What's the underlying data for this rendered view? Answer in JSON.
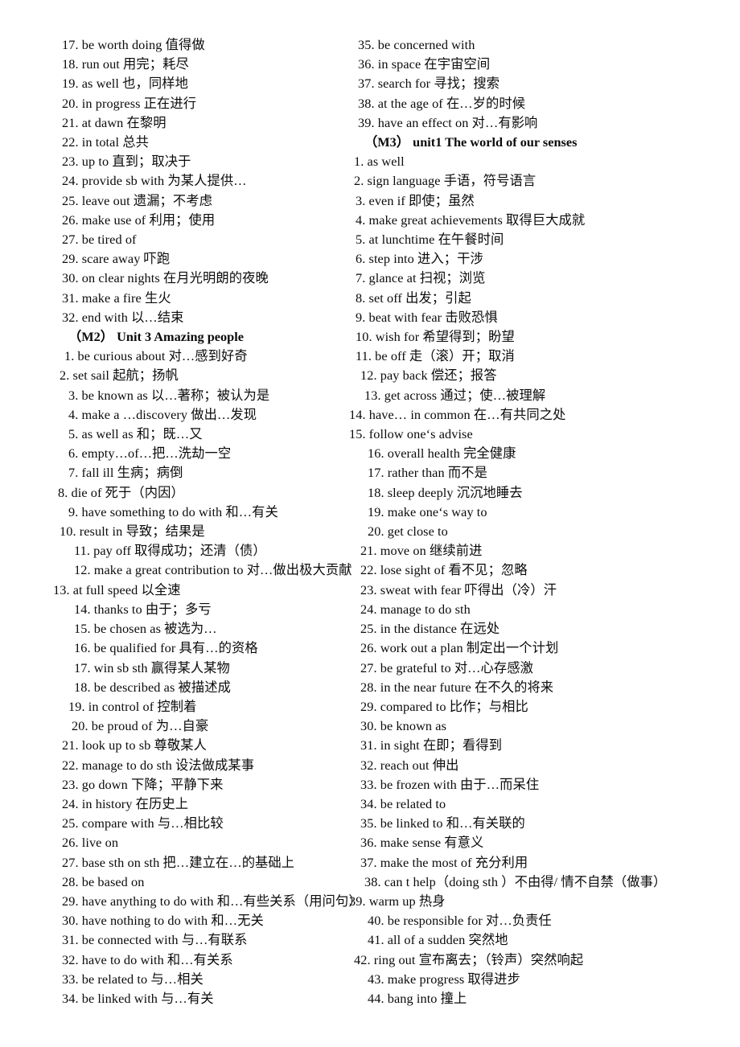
{
  "document": {
    "type": "vocabulary-phrase-list",
    "language": "English-Chinese",
    "columns": 2
  },
  "left_column": [
    {
      "kind": "entry",
      "num": "17.",
      "text": "be worth doing  值得做",
      "indent": "i2"
    },
    {
      "kind": "entry",
      "num": "18.",
      "text": "run out  用完；耗尽",
      "indent": "i2"
    },
    {
      "kind": "entry",
      "num": "19.",
      "text": "as well  也，同样地",
      "indent": "i2"
    },
    {
      "kind": "entry",
      "num": "20.",
      "text": "in progress  正在进行",
      "indent": "i2"
    },
    {
      "kind": "entry",
      "num": "21.",
      "text": "at dawn  在黎明",
      "indent": "i2"
    },
    {
      "kind": "entry",
      "num": "22.",
      "text": "in total 总共",
      "indent": "i2"
    },
    {
      "kind": "entry",
      "num": "23.",
      "text": "up to  直到；取决于",
      "indent": "i2"
    },
    {
      "kind": "entry",
      "num": "24.",
      "text": "provide sb with  为某人提供…",
      "indent": "i2"
    },
    {
      "kind": "entry",
      "num": "25.",
      "text": "leave out  遗漏；不考虑",
      "indent": "i2"
    },
    {
      "kind": "entry",
      "num": "26.",
      "text": "make use of  利用；使用",
      "indent": "i2"
    },
    {
      "kind": "entry",
      "num": "27.",
      "text": "be tired of",
      "indent": "i2"
    },
    {
      "kind": "entry",
      "num": "29.",
      "text": "scare away 吓跑",
      "indent": "i2"
    },
    {
      "kind": "entry",
      "num": "30.",
      "text": "on clear nights  在月光明朗的夜晚",
      "indent": "i2"
    },
    {
      "kind": "entry",
      "num": "31.",
      "text": "make a fire  生火",
      "indent": "i2"
    },
    {
      "kind": "entry",
      "num": "32.",
      "text": "end with 以…结束",
      "indent": "i2"
    },
    {
      "kind": "heading",
      "text": "（M2）   Unit 3 Amazing people",
      "indent": "i4"
    },
    {
      "kind": "entry",
      "num": "1.",
      "text": "be curious about  对…感到好奇",
      "indent": "i3"
    },
    {
      "kind": "entry",
      "num": "2.",
      "text": "set sail  起航；扬帆",
      "indent": "i1"
    },
    {
      "kind": "entry",
      "num": "3.",
      "text": "be known as 以…著称；被认为是",
      "indent": "i4"
    },
    {
      "kind": "entry",
      "num": "4.",
      "text": "make a  …discovery  做出…发现",
      "indent": "i4"
    },
    {
      "kind": "entry",
      "num": "5.",
      "text": "as well as  和；既…又",
      "indent": "i4"
    },
    {
      "kind": "entry",
      "num": "6.",
      "text": "empty…of…把…洗劫一空",
      "indent": "i4"
    },
    {
      "kind": "entry",
      "num": "7.",
      "text": "fall ill  生病；病倒",
      "indent": "i4"
    },
    {
      "kind": "entry",
      "num": "8.",
      "text": "die of  死于（内因）",
      "indent": "i0"
    },
    {
      "kind": "entry",
      "num": "9.",
      "text": "have something to do with 和…有关",
      "indent": "i4"
    },
    {
      "kind": "entry",
      "num": "10.",
      "text": "result in  导致；结果是",
      "indent": "i1"
    },
    {
      "kind": "entry",
      "num": "11.",
      "text": "pay off 取得成功；还清（债）",
      "indent": "i6"
    },
    {
      "kind": "entry",
      "num": "12.",
      "text": "make a great contribution to 对…做出极大贡献",
      "indent": "i6"
    },
    {
      "kind": "entry",
      "num": "13.",
      "text": "at full speed  以全速",
      "indent": "ineg"
    },
    {
      "kind": "entry",
      "num": "14.",
      "text": "thanks to  由于；多亏",
      "indent": "i6"
    },
    {
      "kind": "entry",
      "num": "15.",
      "text": "be chosen as 被选为…",
      "indent": "i6"
    },
    {
      "kind": "entry",
      "num": "16.",
      "text": "be qualified for 具有…的资格",
      "indent": "i6"
    },
    {
      "kind": "entry",
      "num": "17.",
      "text": "win sb sth 赢得某人某物",
      "indent": "i6"
    },
    {
      "kind": "entry",
      "num": "18.",
      "text": "be described as  被描述成",
      "indent": "i6"
    },
    {
      "kind": "entry",
      "num": "19.",
      "text": "in control of  控制着",
      "indent": "i4"
    },
    {
      "kind": "entry",
      "num": "20.",
      "text": "be proud of  为…自豪",
      "indent": "i5"
    },
    {
      "kind": "entry",
      "num": "21.",
      "text": "look up to sb  尊敬某人",
      "indent": "i2"
    },
    {
      "kind": "entry",
      "num": "22.",
      "text": "manage to do sth 设法做成某事",
      "indent": "i2"
    },
    {
      "kind": "entry",
      "num": "23.",
      "text": "go down  下降；平静下来",
      "indent": "i2"
    },
    {
      "kind": "entry",
      "num": "24.",
      "text": "in history 在历史上",
      "indent": "i2"
    },
    {
      "kind": "entry",
      "num": "25.",
      "text": "compare with 与…相比较",
      "indent": "i2"
    },
    {
      "kind": "entry",
      "num": "26.",
      "text": "live on",
      "indent": "i2"
    },
    {
      "kind": "entry",
      "num": "27.",
      "text": "base sth on sth  把…建立在…的基础上",
      "indent": "i2"
    },
    {
      "kind": "entry",
      "num": "28.",
      "text": "be based on",
      "indent": "i2"
    },
    {
      "kind": "entry",
      "num": "29.",
      "text": "have anything to do with 和…有些关系（用问句）",
      "indent": "i2"
    },
    {
      "kind": "entry",
      "num": "30.",
      "text": "have nothing to do with  和…无关",
      "indent": "i2"
    },
    {
      "kind": "entry",
      "num": "31.",
      "text": "be connected with  与…有联系",
      "indent": "i2"
    },
    {
      "kind": "entry",
      "num": "32.",
      "text": "have to do with  和…有关系",
      "indent": "i2"
    },
    {
      "kind": "entry",
      "num": "33.",
      "text": "be related to  与…相关",
      "indent": "i2"
    },
    {
      "kind": "entry",
      "num": "34.",
      "text": "be linked with 与…有关",
      "indent": "i2"
    }
  ],
  "right_column": [
    {
      "kind": "entry",
      "num": "35.",
      "text": "be concerned with",
      "indent": "i2"
    },
    {
      "kind": "entry",
      "num": "36.",
      "text": "in space 在宇宙空间",
      "indent": "i2"
    },
    {
      "kind": "entry",
      "num": "37.",
      "text": "search for 寻找；搜索",
      "indent": "i2"
    },
    {
      "kind": "entry",
      "num": "38.",
      "text": "at the age of  在…岁的时候",
      "indent": "i2"
    },
    {
      "kind": "entry",
      "num": "39.",
      "text": "have an effect on  对…有影响",
      "indent": "i2"
    },
    {
      "kind": "heading",
      "text": "（M3）   unit1 The world of our senses",
      "indent": "i4"
    },
    {
      "kind": "entry",
      "num": "1.",
      "text": "as well",
      "indent": "i0"
    },
    {
      "kind": "entry",
      "num": "2.",
      "text": "sign language 手语，符号语言",
      "indent": "i0"
    },
    {
      "kind": "entry",
      "num": "3.",
      "text": "even if 即使；虽然",
      "indent": "i1"
    },
    {
      "kind": "entry",
      "num": "4.",
      "text": "make great achievements 取得巨大成就",
      "indent": "i1"
    },
    {
      "kind": "entry",
      "num": "5.",
      "text": "at lunchtime 在午餐时间",
      "indent": "i1"
    },
    {
      "kind": "entry",
      "num": "6.",
      "text": "step into 进入；干涉",
      "indent": "i1"
    },
    {
      "kind": "entry",
      "num": "7.",
      "text": "glance at 扫视；浏览",
      "indent": "i1"
    },
    {
      "kind": "entry",
      "num": "8.",
      "text": "set off 出发；引起",
      "indent": "i1"
    },
    {
      "kind": "entry",
      "num": "9.",
      "text": "beat with fear  击败恐惧",
      "indent": "i1"
    },
    {
      "kind": "entry",
      "num": "10.",
      "text": "wish for 希望得到；盼望",
      "indent": "i1"
    },
    {
      "kind": "entry",
      "num": "11.",
      "text": "be off 走（滚）开；取消",
      "indent": "i1"
    },
    {
      "kind": "entry",
      "num": "12.",
      "text": "pay back 偿还；报答",
      "indent": "i3"
    },
    {
      "kind": "entry",
      "num": "13.",
      "text": "get across 通过；使…被理解",
      "indent": "i4"
    },
    {
      "kind": "entry",
      "num": "14.",
      "text": "have…  in common 在…有共同之处",
      "indent": "ineg"
    },
    {
      "kind": "entry",
      "num": "15.",
      "text": "follow one‘s advise",
      "indent": "ineg"
    },
    {
      "kind": "entry",
      "num": "16.",
      "text": "overall health 完全健康",
      "indent": "i5"
    },
    {
      "kind": "entry",
      "num": "17.",
      "text": "rather than  而不是",
      "indent": "i5"
    },
    {
      "kind": "entry",
      "num": "18.",
      "text": "sleep deeply 沉沉地睡去",
      "indent": "i5"
    },
    {
      "kind": "entry",
      "num": "19.",
      "text": "make one‘s way to",
      "indent": "i5"
    },
    {
      "kind": "entry",
      "num": "20.",
      "text": "get close to",
      "indent": "i5"
    },
    {
      "kind": "entry",
      "num": "21.",
      "text": "move on  继续前进",
      "indent": "i3"
    },
    {
      "kind": "entry",
      "num": "22.",
      "text": "lose sight of  看不见；忽略",
      "indent": "i3"
    },
    {
      "kind": "entry",
      "num": "23.",
      "text": "sweat with fear  吓得出（冷）汗",
      "indent": "i3"
    },
    {
      "kind": "entry",
      "num": "24.",
      "text": "manage to do sth",
      "indent": "i3"
    },
    {
      "kind": "entry",
      "num": "25.",
      "text": "in the distance  在远处",
      "indent": "i3"
    },
    {
      "kind": "entry",
      "num": "26.",
      "text": "work out a plan  制定出一个计划",
      "indent": "i3"
    },
    {
      "kind": "entry",
      "num": "27.",
      "text": "be grateful to 对…心存感激",
      "indent": "i3"
    },
    {
      "kind": "entry",
      "num": "28.",
      "text": "in the near future 在不久的将来",
      "indent": "i3"
    },
    {
      "kind": "entry",
      "num": "29.",
      "text": "compared to  比作；与相比",
      "indent": "i3"
    },
    {
      "kind": "entry",
      "num": "30.",
      "text": "be known as",
      "indent": "i3"
    },
    {
      "kind": "entry",
      "num": "31.",
      "text": "in sight 在即；看得到",
      "indent": "i3"
    },
    {
      "kind": "entry",
      "num": "32.",
      "text": "reach out  伸出",
      "indent": "i3"
    },
    {
      "kind": "entry",
      "num": "33.",
      "text": "be frozen with 由于…而呆住",
      "indent": "i3"
    },
    {
      "kind": "entry",
      "num": "34.",
      "text": "be related to",
      "indent": "i3"
    },
    {
      "kind": "entry",
      "num": "35.",
      "text": "be linked to 和…有关联的",
      "indent": "i3"
    },
    {
      "kind": "entry",
      "num": "36.",
      "text": "make sense 有意义",
      "indent": "i3"
    },
    {
      "kind": "entry",
      "num": "37.",
      "text": "make the most of 充分利用",
      "indent": "i3"
    },
    {
      "kind": "entry",
      "num": "38.",
      "text": "can t help（doing sth ）不由得/ 情不自禁（做事）",
      "indent": "i4"
    },
    {
      "kind": "entry",
      "num": "39.",
      "text": "warm up  热身",
      "indent": "ineg"
    },
    {
      "kind": "entry",
      "num": "40.",
      "text": "be responsible for 对…负责任",
      "indent": "i5"
    },
    {
      "kind": "entry",
      "num": "41.",
      "text": "all of a sudden  突然地",
      "indent": "i5"
    },
    {
      "kind": "entry",
      "num": "42.",
      "text": "ring out 宣布离去；（铃声）突然响起",
      "indent": "i0"
    },
    {
      "kind": "entry",
      "num": "43.",
      "text": "make progress  取得进步",
      "indent": "i5"
    },
    {
      "kind": "entry",
      "num": "44.",
      "text": "bang into  撞上",
      "indent": "i5"
    }
  ]
}
